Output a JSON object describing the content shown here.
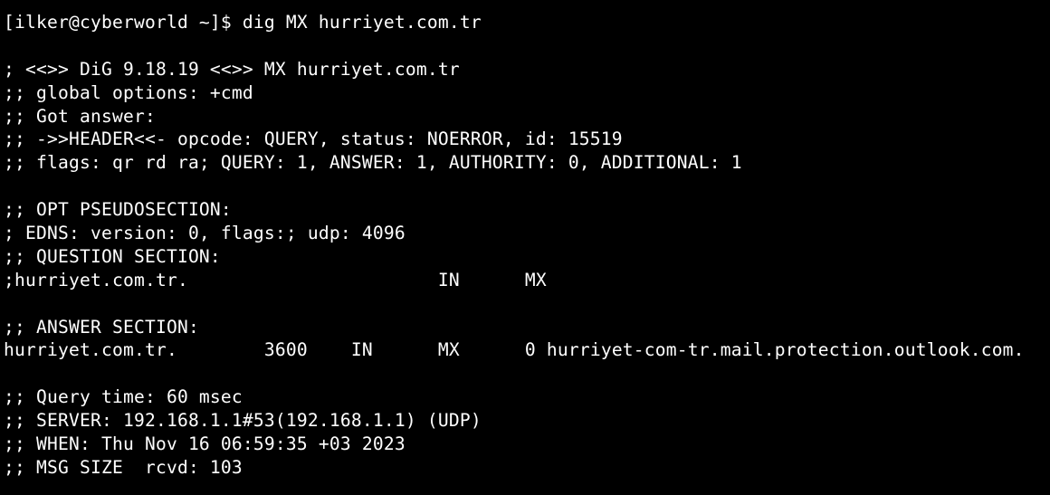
{
  "terminal": {
    "lines": [
      "[ilker@cyberworld ~]$ dig MX hurriyet.com.tr",
      "",
      "; <<>> DiG 9.18.19 <<>> MX hurriyet.com.tr",
      ";; global options: +cmd",
      ";; Got answer:",
      ";; ->>HEADER<<- opcode: QUERY, status: NOERROR, id: 15519",
      ";; flags: qr rd ra; QUERY: 1, ANSWER: 1, AUTHORITY: 0, ADDITIONAL: 1",
      "",
      ";; OPT PSEUDOSECTION:",
      "; EDNS: version: 0, flags:; udp: 4096",
      ";; QUESTION SECTION:",
      ";hurriyet.com.tr.\t\t\tIN\tMX",
      "",
      ";; ANSWER SECTION:",
      "hurriyet.com.tr.\t3600\tIN\tMX\t0 hurriyet-com-tr.mail.protection.outlook.com.",
      "",
      ";; Query time: 60 msec",
      ";; SERVER: 192.168.1.1#53(192.168.1.1) (UDP)",
      ";; WHEN: Thu Nov 16 06:59:35 +03 2023",
      ";; MSG SIZE  rcvd: 103"
    ]
  }
}
